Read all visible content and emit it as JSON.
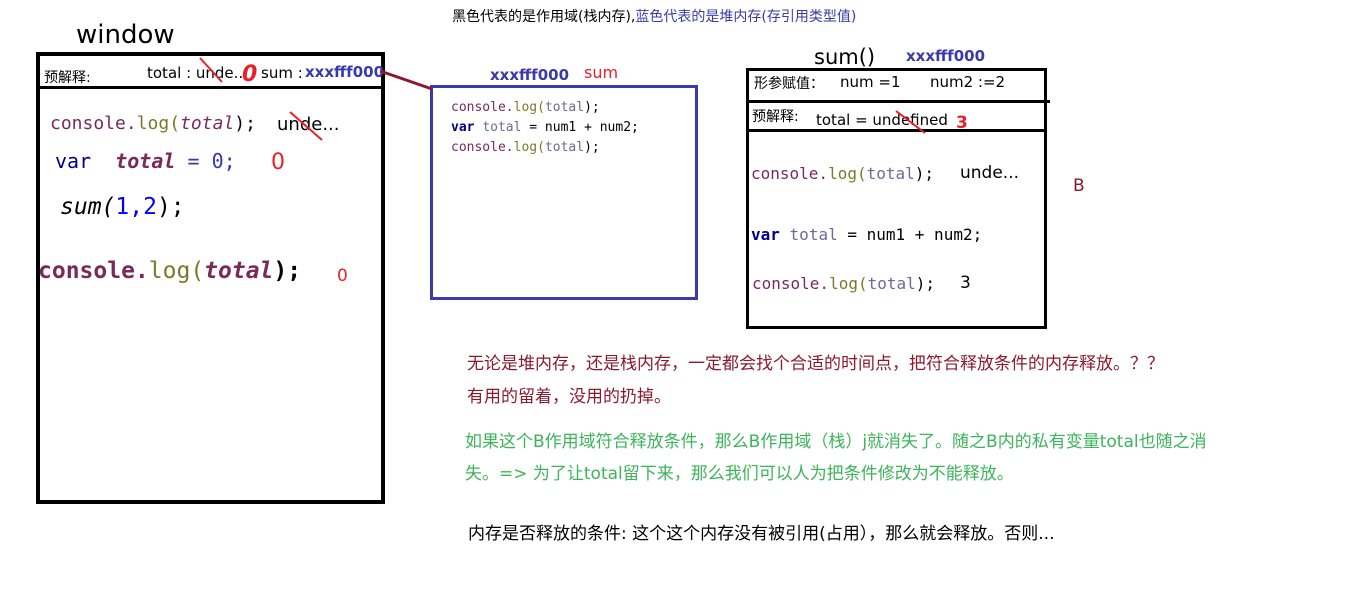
{
  "header": {
    "part1": "黑色代表的是作用域(栈内存),",
    "part2": "蓝色代表的是堆内存(存引用类型值)"
  },
  "window_box": {
    "title": "window",
    "preparse_label": "预解释:",
    "total_label": "total : unde..",
    "total_value": "0",
    "sum_label": "sum :",
    "sum_address": "xxxfff000",
    "line1_code": "console.",
    "line1_fn": "log(",
    "line1_var": "total",
    "line1_end": ");",
    "line1_result": "unde...",
    "line2_kw": "var",
    "line2_var": "total",
    "line2_rest": "= 0;",
    "line2_result": "0",
    "line3_fn": "sum(",
    "line3_args": "1,2",
    "line3_end": ");",
    "line4_code": "console.",
    "line4_fn": "log(",
    "line4_var": "total",
    "line4_end": ");",
    "line4_result": "0"
  },
  "heap_box": {
    "address": "xxxfff000",
    "name": "sum",
    "lines": [
      {
        "a": "console.",
        "b": "log(",
        "c": "total",
        "d": ");"
      },
      {
        "a": "var",
        "b": "total",
        "c": "=  num1 + num2;"
      },
      {
        "a": "console.",
        "b": "log(",
        "c": "total",
        "d": ");"
      }
    ]
  },
  "sum_box": {
    "title": "sum()",
    "address": "xxxfff000",
    "params_label": "形参赋值：",
    "params_value1": "num =1",
    "params_value2": "num2 :=2",
    "preparse_label": "预解释:",
    "preparse_value": "total = undefined",
    "preparse_new": "3",
    "line1_a": "console.",
    "line1_b": "log(",
    "line1_c": "total",
    "line1_d": ");",
    "line1_result": "unde...",
    "line2_a": "var",
    "line2_b": "total",
    "line2_c": "=  num1 + num2;",
    "line3_a": "console.",
    "line3_b": "log(",
    "line3_c": "total",
    "line3_d": ");",
    "line3_result": "3",
    "scope_label": "B"
  },
  "notes": {
    "p1_line1": "无论是堆内存，还是栈内存，一定都会找个合适的时间点，把符合释放条件的内存释放。？？",
    "p1_line2": "有用的留着，没用的扔掉。",
    "p2_line1": "如果这个B作用域符合释放条件，那么B作用域（栈）j就消失了。随之B内的私有变量total也随之消",
    "p2_line2": "失。=> 为了让total留下来，那么我们可以人为把条件修改为不能释放。",
    "p3": "内存是否释放的条件: 这个这个内存没有被引用(占用），那么就会释放。否则..."
  },
  "colors": {
    "scope_border": "#000000",
    "heap_border": "#3a3aa8",
    "annotation_red": "#e8202a",
    "green_text": "#3cb55a",
    "darkred_text": "#8b1a2c"
  }
}
